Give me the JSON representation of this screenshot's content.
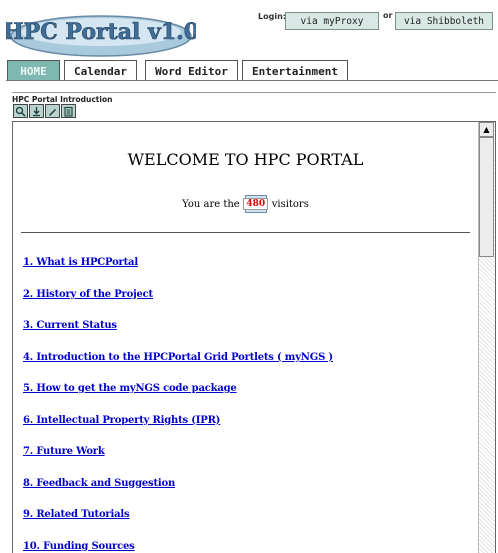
{
  "header": {
    "logo_text": "HPC Portal v1.0",
    "login_label": "Login:",
    "proxy_button": "via myProxy",
    "or_label": "or",
    "shibboleth_button": "via Shibboleth"
  },
  "tabs": [
    {
      "label": "HOME",
      "active": true
    },
    {
      "label": "Calendar",
      "active": false
    },
    {
      "label": "Word Editor",
      "active": false
    },
    {
      "label": "Entertainment",
      "active": false
    }
  ],
  "portlet": {
    "title": "HPC Portal Introduction",
    "tool_icons": [
      "zoom-icon",
      "download-icon",
      "edit-icon",
      "notes-icon"
    ]
  },
  "content": {
    "welcome": "WELCOME TO HPC PORTAL",
    "visitors_prefix": "You are the",
    "visitor_count": "480",
    "visitors_suffix": "visitors",
    "links": [
      "1. What is HPCPortal",
      "2. History of the Project",
      "3. Current Status",
      "4. Introduction to the HPCPortal Grid Portlets ( myNGS )",
      "5. How to get the myNGS code package",
      "6. Intellectual Property Rights (IPR)",
      "7. Future Work",
      "8. Feedback and Suggestion",
      "9. Related Tutorials",
      "10. Funding Sources"
    ]
  },
  "colors": {
    "active_tab": "#7fb8b0",
    "link": "#0000cc",
    "button_bg": "#d7e8e5",
    "counter_text": "#dd0000"
  }
}
